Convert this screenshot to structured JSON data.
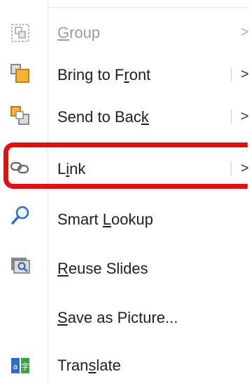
{
  "menu": {
    "items": {
      "group": {
        "label_pre": "",
        "label_acc": "G",
        "label_post": "roup",
        "shortcut": ">",
        "icon": "group-icon",
        "disabled": true
      },
      "bring_to_front": {
        "label_pre": "Bring to F",
        "label_acc": "r",
        "label_post": "ont",
        "shortcut": ">",
        "icon": "bring-to-front-icon"
      },
      "send_to_back": {
        "label_pre": "Send to Bac",
        "label_acc": "k",
        "label_post": "",
        "shortcut": ">",
        "icon": "send-to-back-icon"
      },
      "link": {
        "label_pre": "L",
        "label_acc": "i",
        "label_post": "nk",
        "shortcut": ">",
        "icon": "link-icon",
        "highlighted": true
      },
      "smart_lookup": {
        "label_pre": "Smart ",
        "label_acc": "L",
        "label_post": "ookup",
        "icon": "smart-lookup-icon"
      },
      "reuse_slides": {
        "label_pre": "",
        "label_acc": "R",
        "label_post": "euse Slides",
        "icon": "reuse-slides-icon"
      },
      "save_as_picture": {
        "label_pre": "",
        "label_acc": "S",
        "label_post": "ave as Picture...",
        "icon": ""
      },
      "translate": {
        "label_pre": "Tran",
        "label_acc": "s",
        "label_post": "late",
        "icon": "translate-icon"
      }
    }
  },
  "colors": {
    "highlight": "#e01010",
    "accent": "#2b6cc4",
    "icon_orange": "#f0a020",
    "disabled": "#9c9c9c"
  }
}
